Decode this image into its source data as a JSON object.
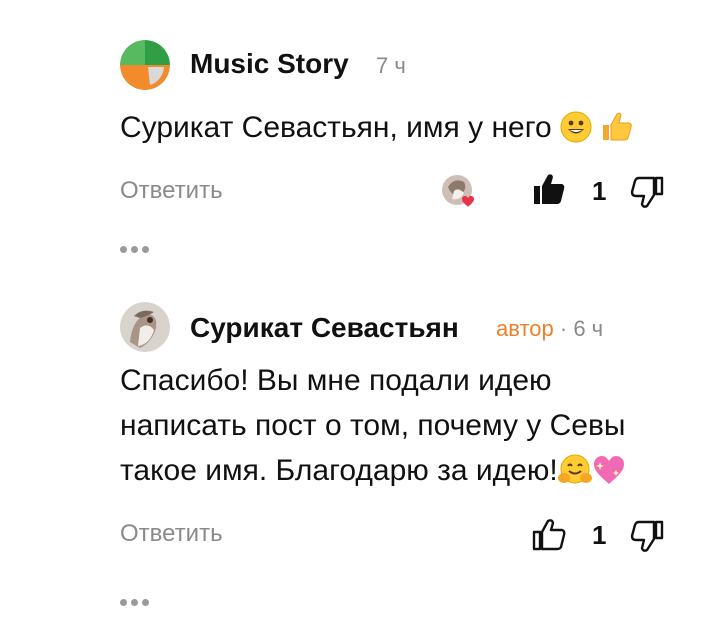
{
  "comments": [
    {
      "author": "Music Story",
      "time": "7 ч",
      "text": "Сурикат Севастьян, имя у него",
      "reply_label": "Ответить",
      "likes": "1",
      "liked": true,
      "avatar_icon": "music-story-logo",
      "colors": {
        "green": "#4cb050",
        "orange": "#f28b2b",
        "grey": "#c9c9c9"
      }
    },
    {
      "author": "Сурикат Севастьян",
      "author_badge": "автор",
      "time_sep": "·",
      "time": "6 ч",
      "text_lines": [
        "Спасибо! Вы мне подали идею",
        "написать пост о том, почему у Севы",
        "такое имя. Благодарю за идею!"
      ],
      "reply_label": "Ответить",
      "likes": "1",
      "liked": false,
      "avatar_icon": "meerkat-avatar"
    }
  ],
  "colors": {
    "author_badge": "#f07f2a",
    "muted": "#8a8a8a",
    "heart": "#e6334a"
  }
}
